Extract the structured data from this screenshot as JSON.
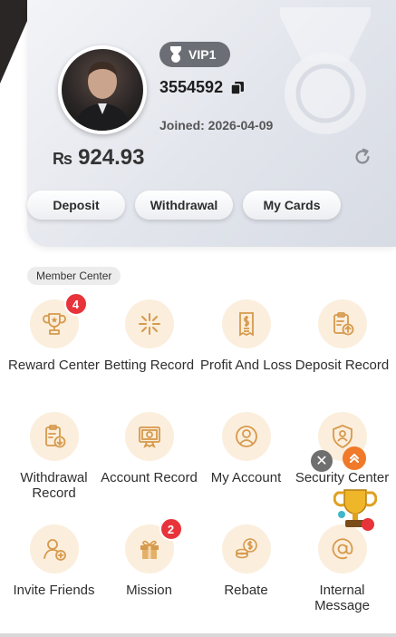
{
  "profile": {
    "vip_label": "VIP1",
    "user_id": "3554592",
    "joined": "Joined:  2026-04-09",
    "currency_symbol": "₨",
    "balance": "924.93"
  },
  "actions": {
    "deposit": "Deposit",
    "withdrawal": "Withdrawal",
    "my_cards": "My Cards"
  },
  "member_center": {
    "title": "Member Center",
    "items": [
      {
        "label": "Reward Center",
        "icon": "trophy-icon",
        "badge": "4"
      },
      {
        "label": "Betting Record",
        "icon": "spark-icon"
      },
      {
        "label": "Profit And Loss",
        "icon": "receipt-icon"
      },
      {
        "label": "Deposit Record",
        "icon": "clipboard-up-icon"
      },
      {
        "label": "Withdrawal Record",
        "icon": "clipboard-down-icon"
      },
      {
        "label": "Account Record",
        "icon": "certificate-icon"
      },
      {
        "label": "My Account",
        "icon": "user-icon"
      },
      {
        "label": "Security Center",
        "icon": "shield-user-icon"
      },
      {
        "label": "Invite Friends",
        "icon": "add-user-icon"
      },
      {
        "label": "Mission",
        "icon": "gift-icon",
        "badge": "2"
      },
      {
        "label": "Rebate",
        "icon": "coins-icon"
      },
      {
        "label": "Internal Message",
        "icon": "at-sign-icon"
      }
    ]
  },
  "floating": {
    "close_glyph": "✕"
  },
  "colors": {
    "icon_bg": "#fbeedd",
    "icon_stroke": "#d69a4c",
    "badge_red": "#e8333a",
    "vip_bg": "#6b6e74"
  }
}
